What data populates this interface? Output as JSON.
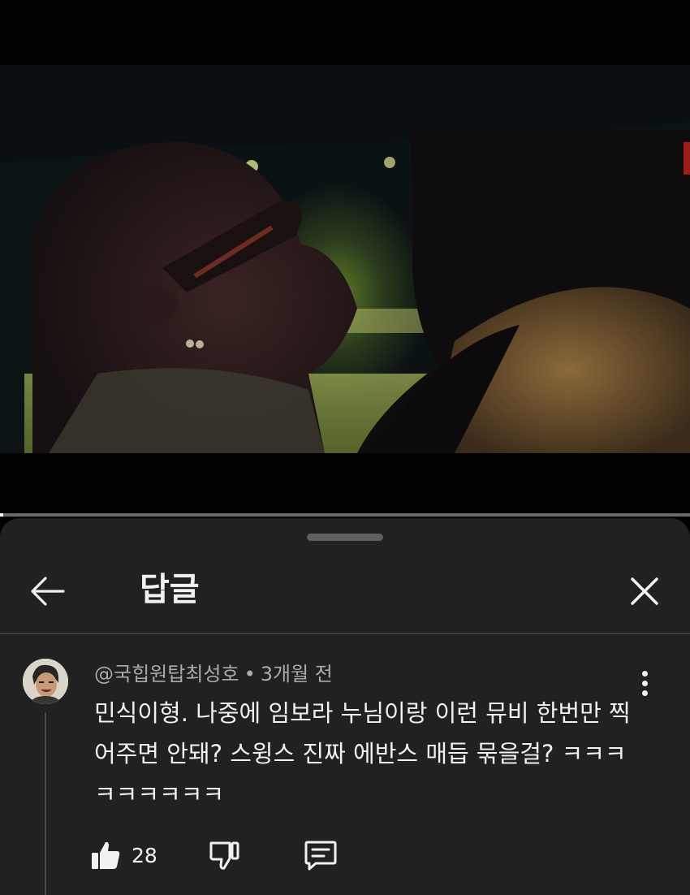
{
  "video": {
    "progress_fraction": 0.005
  },
  "sheet": {
    "title": "답글",
    "back_icon": "arrow-left-icon",
    "close_icon": "close-icon"
  },
  "comment": {
    "author": "@국힙원탑최성호",
    "separator": "•",
    "time_ago": "3개월 전",
    "text": "민식이형. 나중에 임보라 누님이랑 이런 뮤비 한번만 찍어주면 안돼? 스윙스 진짜 에반스 매듭 묶을걸? ㅋㅋㅋㅋㅋㅋㅋㅋㅋ",
    "like_count": "28",
    "icons": {
      "like": "thumbs-up-icon",
      "dislike": "thumbs-down-icon",
      "reply": "reply-comment-icon",
      "more": "more-vertical-icon"
    }
  },
  "colors": {
    "sheet_background": "#212121",
    "text_primary": "#f1f1f1",
    "text_secondary": "#aaaaaa",
    "divider": "#3b3b3b"
  }
}
